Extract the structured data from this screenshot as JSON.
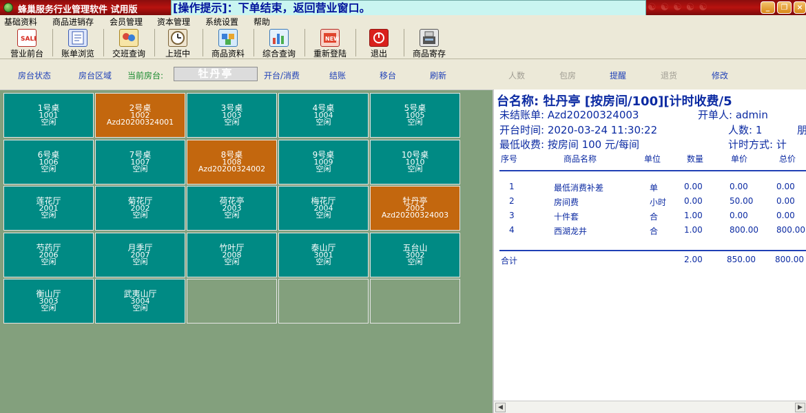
{
  "app": {
    "title": "蜂巢服务行业管理软件  试用版",
    "hint": "[操作提示]：下单结束，返回营业窗口。"
  },
  "window_buttons": [
    "_",
    "❐",
    "×"
  ],
  "menu": [
    "基础资料",
    "商品进销存",
    "会员管理",
    "资本管理",
    "系统设置",
    "帮助"
  ],
  "toolbar": [
    {
      "label": "营业前台",
      "icon": "sale-icon",
      "color": "#e9473a"
    },
    {
      "label": "账单浏览",
      "icon": "bill-icon",
      "color": "#5b7fd6"
    },
    {
      "label": "交班查询",
      "icon": "handover-icon",
      "color": "#e2b748"
    },
    {
      "label": "上班中",
      "icon": "clock-icon",
      "color": "#8b6f4a"
    },
    {
      "label": "商品资料",
      "icon": "goods-icon",
      "color": "#6aa8e8"
    },
    {
      "label": "综合查询",
      "icon": "chart-icon",
      "color": "#5aa0d8"
    },
    {
      "label": "重新登陆",
      "icon": "relogin-icon",
      "color": "#e0452e"
    },
    {
      "label": "退出",
      "icon": "power-icon",
      "color": "#d9211c"
    },
    {
      "label": "商品寄存",
      "icon": "register-icon",
      "color": "#9a9a9a"
    }
  ],
  "actions": {
    "room_status": "房台状态",
    "room_area": "房台区域",
    "current_room_label": "当前房台:",
    "current_room_value": "牡丹亭",
    "open_consume": "开台/消费",
    "checkout": "结账",
    "move_table": "移台",
    "refresh": "刷新",
    "people": "人数",
    "private_room": "包房",
    "remind": "提醒",
    "return_goods": "退货",
    "modify": "修改"
  },
  "tables": [
    {
      "name": "1号桌",
      "code": "1001",
      "status": "空闲",
      "busy": false
    },
    {
      "name": "2号桌",
      "code": "1002",
      "status": "Azd20200324001",
      "busy": true
    },
    {
      "name": "3号桌",
      "code": "1003",
      "status": "空闲",
      "busy": false
    },
    {
      "name": "4号桌",
      "code": "1004",
      "status": "空闲",
      "busy": false
    },
    {
      "name": "5号桌",
      "code": "1005",
      "status": "空闲",
      "busy": false
    },
    {
      "name": "6号桌",
      "code": "1006",
      "status": "空闲",
      "busy": false
    },
    {
      "name": "7号桌",
      "code": "1007",
      "status": "空闲",
      "busy": false
    },
    {
      "name": "8号桌",
      "code": "1008",
      "status": "Azd20200324002",
      "busy": true
    },
    {
      "name": "9号桌",
      "code": "1009",
      "status": "空闲",
      "busy": false
    },
    {
      "name": "10号桌",
      "code": "1010",
      "status": "空闲",
      "busy": false
    },
    {
      "name": "莲花厅",
      "code": "2001",
      "status": "空闲",
      "busy": false
    },
    {
      "name": "菊花厅",
      "code": "2002",
      "status": "空闲",
      "busy": false
    },
    {
      "name": "荷花亭",
      "code": "2003",
      "status": "空闲",
      "busy": false
    },
    {
      "name": "梅花厅",
      "code": "2004",
      "status": "空闲",
      "busy": false
    },
    {
      "name": "牡丹亭",
      "code": "2005",
      "status": "Azd20200324003",
      "busy": true
    },
    {
      "name": "芍药厅",
      "code": "2006",
      "status": "空闲",
      "busy": false
    },
    {
      "name": "月季厅",
      "code": "2007",
      "status": "空闲",
      "busy": false
    },
    {
      "name": "竹叶厅",
      "code": "2008",
      "status": "空闲",
      "busy": false
    },
    {
      "name": "泰山厅",
      "code": "3001",
      "status": "空闲",
      "busy": false
    },
    {
      "name": "五台山",
      "code": "3002",
      "status": "空闲",
      "busy": false
    },
    {
      "name": "衡山厅",
      "code": "3003",
      "status": "空闲",
      "busy": false
    },
    {
      "name": "武夷山厅",
      "code": "3004",
      "status": "空闲",
      "busy": false
    }
  ],
  "empty_slots": 3,
  "detail": {
    "title": "台名称: 牡丹亭 [按房间/100][计时收费/5",
    "bill_label": "未结账单: Azd20200324003",
    "opener_label": "开单人: admin",
    "open_time_label": "开台时间: 2020-03-24 11:30:22",
    "people_label": "人数: 1",
    "people_trailing": "朋",
    "min_fee_label": "最低收费: 按房间 100 元/每间",
    "timing_label": "计时方式: 计",
    "columns": [
      "序号",
      "商品名称",
      "单位",
      "数量",
      "单价",
      "总价"
    ],
    "rows": [
      {
        "no": "1",
        "name": "最低消费补差",
        "unit": "单",
        "qty": "0.00",
        "price": "0.00",
        "total": "0.00"
      },
      {
        "no": "2",
        "name": "房间费",
        "unit": "小时",
        "qty": "0.00",
        "price": "50.00",
        "total": "0.00"
      },
      {
        "no": "3",
        "name": "十件套",
        "unit": "合",
        "qty": "1.00",
        "price": "0.00",
        "total": "0.00"
      },
      {
        "no": "4",
        "name": "西湖龙井",
        "unit": "合",
        "qty": "1.00",
        "price": "800.00",
        "total": "800.00"
      }
    ],
    "total": {
      "label": "合计",
      "qty": "2.00",
      "price": "850.00",
      "total": "800.00"
    }
  }
}
